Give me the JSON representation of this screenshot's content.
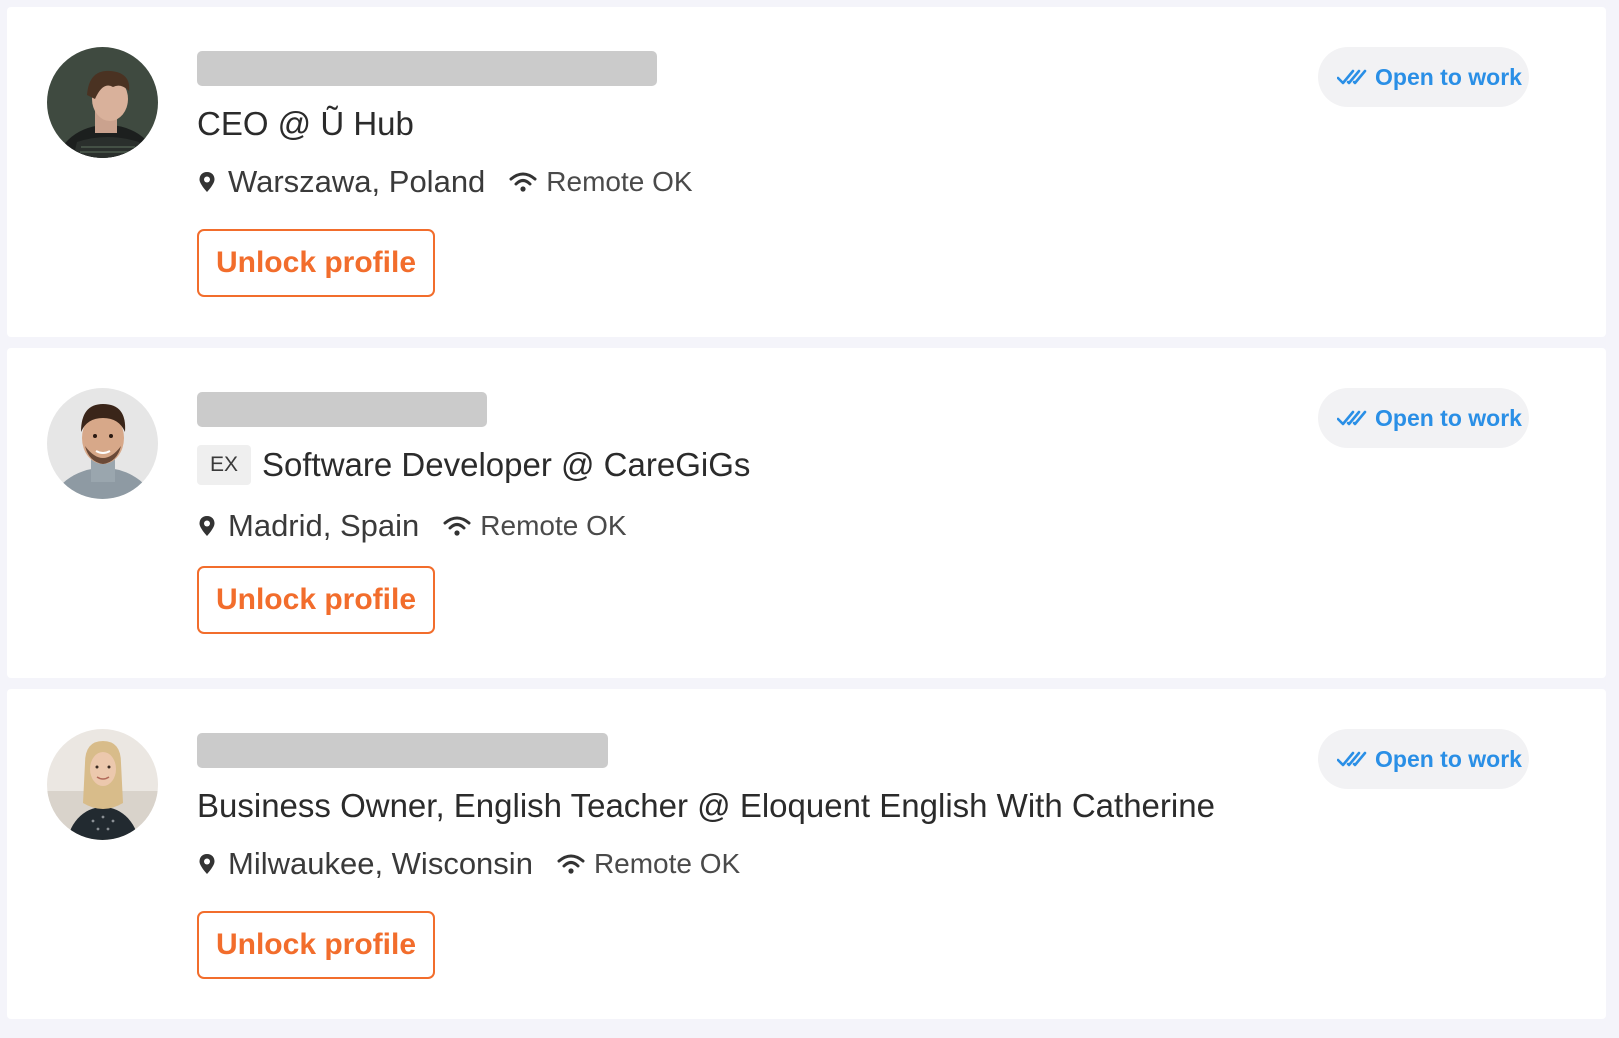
{
  "candidates": [
    {
      "title": "CEO @ Ũ Hub",
      "ex_badge": "",
      "location": "Warszawa, Poland",
      "remote": "Remote OK",
      "unlock_label": "Unlock profile",
      "status_label": "Open to work",
      "avatar_icon": "person-photo-icon"
    },
    {
      "title": "Software Developer @ CareGiGs",
      "ex_badge": "EX",
      "location": "Madrid, Spain",
      "remote": "Remote OK",
      "unlock_label": "Unlock profile",
      "status_label": "Open to work",
      "avatar_icon": "person-photo-icon"
    },
    {
      "title": "Business Owner, English Teacher @ Eloquent English With Catherine",
      "ex_badge": "",
      "location": "Milwaukee, Wisconsin",
      "remote": "Remote OK",
      "unlock_label": "Unlock profile",
      "status_label": "Open to work",
      "avatar_icon": "person-photo-icon"
    }
  ],
  "colors": {
    "accent_orange": "#f26d2c",
    "status_blue": "#2a8fe6",
    "page_background": "#f4f4fa",
    "blurred_name": "#cbcbcb"
  },
  "icons": {
    "location": "map-pin-icon",
    "remote": "wifi-icon",
    "status": "double-check-icon"
  }
}
